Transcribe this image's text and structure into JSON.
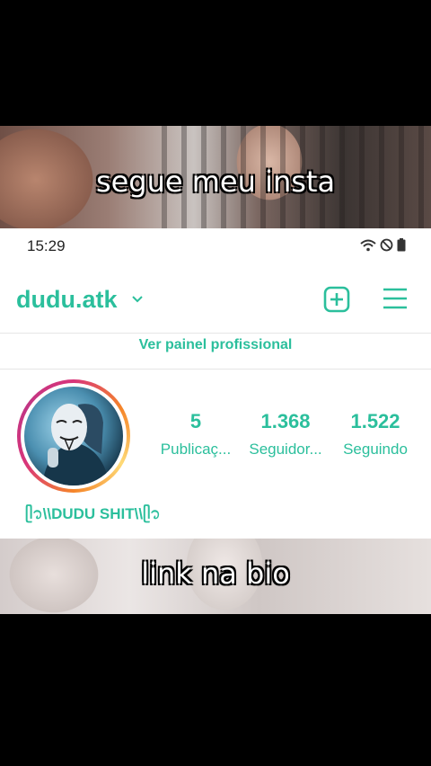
{
  "video": {
    "caption_top": "segue meu insta",
    "caption_bottom": "link na bio"
  },
  "status_bar": {
    "time": "15:29",
    "icons": [
      "wifi-icon",
      "do-not-disturb-icon",
      "battery-icon"
    ]
  },
  "profile": {
    "username": "dudu.atk",
    "professional_dashboard": "Ver painel profissional",
    "display_name": "ᥫ᭡\\\\DUDU SHIT\\\\ᥫ᭡",
    "stats": [
      {
        "value": "5",
        "label": "Publicaç..."
      },
      {
        "value": "1.368",
        "label": "Seguidor..."
      },
      {
        "value": "1.522",
        "label": "Seguindo"
      }
    ]
  },
  "colors": {
    "accent": "#2bbf9c",
    "background": "#ffffff"
  }
}
